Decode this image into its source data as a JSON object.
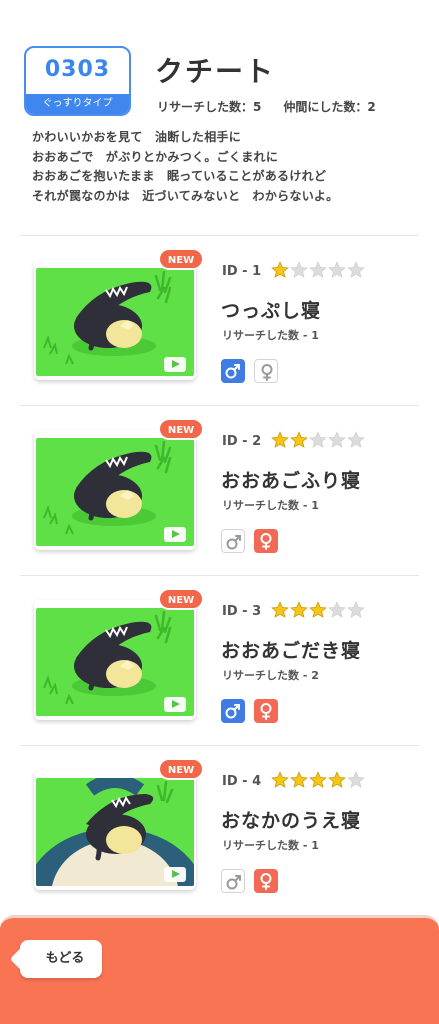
{
  "header": {
    "dex_number": "0303",
    "type_label": "ぐっすりタイプ",
    "name": "クチート",
    "research_count": "リサーチした数：5",
    "friend_count": "仲間にした数：2",
    "description": [
      "かわいいかおを見て　油断した相手に",
      "おおあごで　がぶりとかみつく。ごくまれに",
      "おおあごを抱いたまま　眠っていることがあるけれど",
      "それが罠なのかは　近づいてみないと　わからないよ。"
    ]
  },
  "styles": [
    {
      "badge": "NEW",
      "id_label": "ID - 1",
      "stars": 1,
      "name": "つっぷし寝",
      "count": "リサーチした数 - 1",
      "male": true,
      "female": false,
      "scene": "grass"
    },
    {
      "badge": "NEW",
      "id_label": "ID - 2",
      "stars": 2,
      "name": "おおあごふり寝",
      "count": "リサーチした数 - 1",
      "male": false,
      "female": true,
      "scene": "grass"
    },
    {
      "badge": "NEW",
      "id_label": "ID - 3",
      "stars": 3,
      "name": "おおあごだき寝",
      "count": "リサーチした数 - 2",
      "male": true,
      "female": true,
      "scene": "grass"
    },
    {
      "badge": "NEW",
      "id_label": "ID - 4",
      "stars": 4,
      "name": "おなかのうえ寝",
      "count": "リサーチした数 - 1",
      "male": false,
      "female": true,
      "scene": "snorlax"
    }
  ],
  "footer": {
    "back_label": "もどる"
  },
  "colors": {
    "accent_blue": "#3f86ee",
    "new_badge": "#f2664a",
    "star_on": "#f5c518",
    "star_off": "#dcdcdc",
    "footer": "#f87453",
    "grass": "#5fe046"
  }
}
